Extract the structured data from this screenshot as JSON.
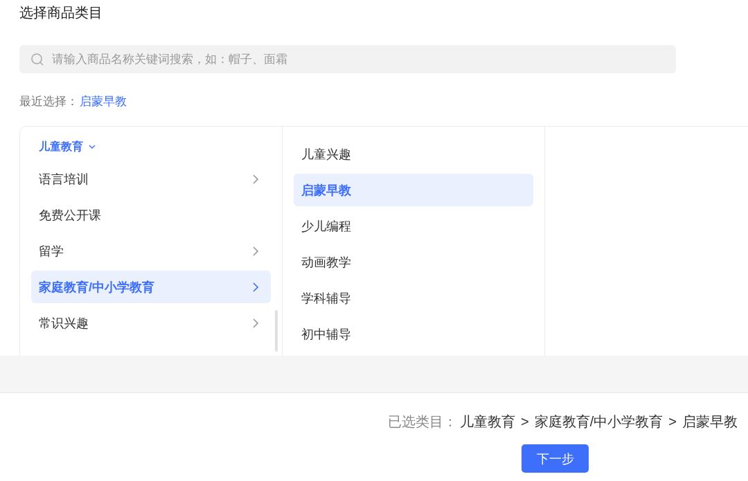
{
  "title": "选择商品类目",
  "search": {
    "placeholder": "请输入商品名称关键词搜索，如：帽子、面霜"
  },
  "recent": {
    "label": "最近选择：",
    "items": [
      "启蒙早教"
    ]
  },
  "columns": [
    {
      "header": {
        "label": "儿童教育",
        "expanded": true
      },
      "items": [
        {
          "label": "语言培训",
          "has_children": true,
          "selected": false
        },
        {
          "label": "免费公开课",
          "has_children": false,
          "selected": false
        },
        {
          "label": "留学",
          "has_children": true,
          "selected": false
        },
        {
          "label": "家庭教育/中小学教育",
          "has_children": true,
          "selected": true
        },
        {
          "label": "常识兴趣",
          "has_children": true,
          "selected": false
        }
      ]
    },
    {
      "items": [
        {
          "label": "儿童兴趣",
          "has_children": false,
          "selected": false
        },
        {
          "label": "启蒙早教",
          "has_children": false,
          "selected": true
        },
        {
          "label": "少儿编程",
          "has_children": false,
          "selected": false
        },
        {
          "label": "动画教学",
          "has_children": false,
          "selected": false
        },
        {
          "label": "学科辅导",
          "has_children": false,
          "selected": false
        },
        {
          "label": "初中辅导",
          "has_children": false,
          "selected": false
        }
      ]
    }
  ],
  "selected_path": {
    "label": "已选类目：",
    "separator": ">",
    "segments": [
      "儿童教育",
      "家庭教育/中小学教育",
      "启蒙早教"
    ]
  },
  "next_button": "下一步"
}
